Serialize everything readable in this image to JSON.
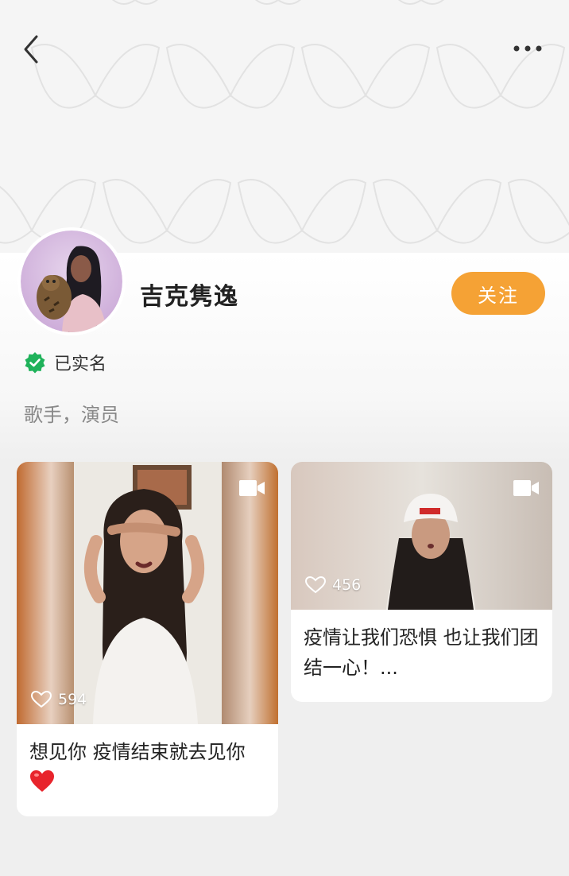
{
  "profile": {
    "name": "吉克隽逸",
    "follow_label": "关注",
    "verified_label": "已实名",
    "bio": "歌手，演员"
  },
  "posts": [
    {
      "likes": "594",
      "caption": "想见你 疫情结束就去见你",
      "caption_emoji": "heart-emoji"
    },
    {
      "likes": "456",
      "caption": "疫情让我们恐惧 也让我们团结一心！..."
    }
  ],
  "colors": {
    "accent": "#f5a235",
    "verified": "#1fb25a",
    "background": "#efefef"
  },
  "icons": [
    "back-arrow-icon",
    "more-icon",
    "verified-badge-icon",
    "video-icon",
    "heart-outline-icon"
  ]
}
